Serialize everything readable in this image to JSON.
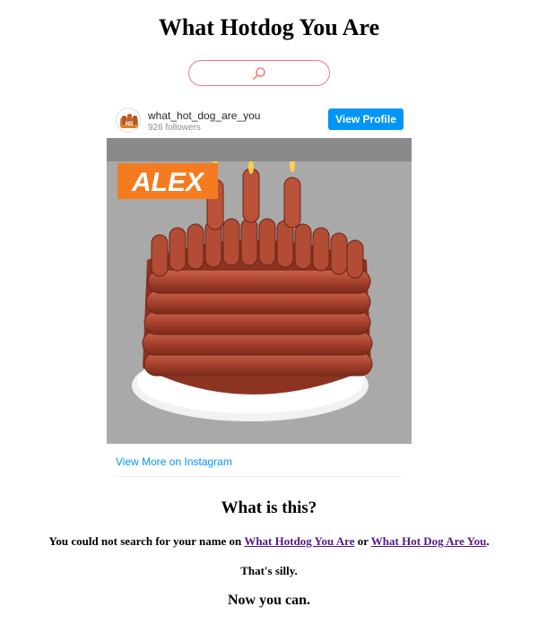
{
  "page": {
    "title": "What Hotdog You Are"
  },
  "search": {
    "icon": "search-icon",
    "border_color": "#f07a7a"
  },
  "instagram_embed": {
    "username": "what_hot_dog_are_you",
    "followers": "926 followers",
    "view_profile_label": "View Profile",
    "view_more_label": "View More on Instagram",
    "image_caption_overlay": "ALEX",
    "image_subject": "hotdog-birthday-cake",
    "accent_color": "#0095f6",
    "overlay_color": "#f47b20"
  },
  "info": {
    "heading": "What is this?",
    "text_before": "You could not search for your name on ",
    "link1": "What Hotdog You Are",
    "text_middle": " or ",
    "link2": "What Hot Dog Are You",
    "text_after": ".",
    "silly": "That's silly.",
    "now": "Now you can."
  }
}
